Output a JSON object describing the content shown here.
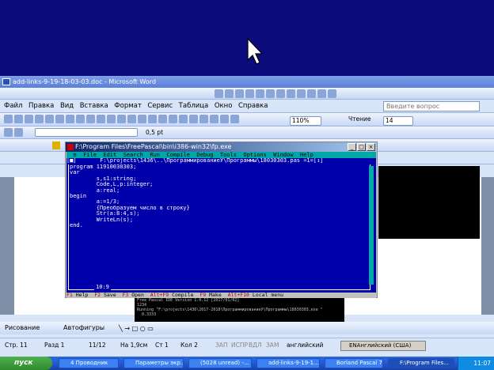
{
  "word": {
    "title": "add-links-9-19-18-03-03.doc - Microsoft Word",
    "menu": [
      "Файл",
      "Правка",
      "Вид",
      "Вставка",
      "Формат",
      "Сервис",
      "Таблица",
      "Окно",
      "Справка"
    ],
    "ask_placeholder": "Введите вопрос",
    "zoom": "110%",
    "read_button": "Чтение",
    "font_size": "14",
    "line_width": "0,5 pt",
    "draw_label": "Рисование",
    "autoshapes_label": "Автофигуры",
    "status": {
      "page": "Стр. 11",
      "section": "Разд 1",
      "pages": "11/12",
      "at": "На 1,9см",
      "line": "Ст 1",
      "col": "Кол 2",
      "rec": "ЗАП",
      "trk": "ИСПР",
      "ext": "ВДЛ",
      "ovr": "ЗАМ",
      "language": "английский"
    }
  },
  "pascal": {
    "title": "F:\\Program Files\\FreePascal\\bin\\i386-win32\\fp.exe",
    "menu": "  ≡  File  Edit  Search  Run  Compile  Debug  Tools  Options  Window  Help",
    "editor_header": "[■]       F:\\projects\\1436\\..\\ПрограммированиеУ\\Программы\\18030303.pas =1=[↕]",
    "code": "program 11910030303;\nvar\n        s,s1:string;\n        Code,L,p:integer;\n        a:real;\nbegin\n        a:=1/3;\n        {Преобразуем число в строку}\n        Str(a:8:4,s);\n        WriteLn(s);\nend.",
    "cursor_pos": "10:9",
    "hints": [
      {
        "key": "F1",
        "label": "Help"
      },
      {
        "key": "F2",
        "label": "Save"
      },
      {
        "key": "F3",
        "label": "Open"
      },
      {
        "key": "Alt+F9",
        "label": "Compile"
      },
      {
        "key": "F9",
        "label": "Make"
      },
      {
        "key": "Alt+F10",
        "label": "Local menu"
      }
    ]
  },
  "console": {
    "lines": "Free Pascal IDE Version 1.0.12 [2017/01/02]\n1234\nRunning \"F:\\projects\\1436\\2017-2018\\ПрограммированиеУ\\Программы\\18030303.exe \"\n  0.3333"
  },
  "language_bar": "ENАнглийский (США)",
  "taskbar": {
    "start_label": "пуск",
    "tasks": [
      "4 Проводник",
      "Параметры экр...",
      "(5028 unread) -...",
      "add-links-9-19-1...",
      "Borland Pascal 7.0",
      "F:\\Program Files..."
    ],
    "clock": "11:07"
  }
}
